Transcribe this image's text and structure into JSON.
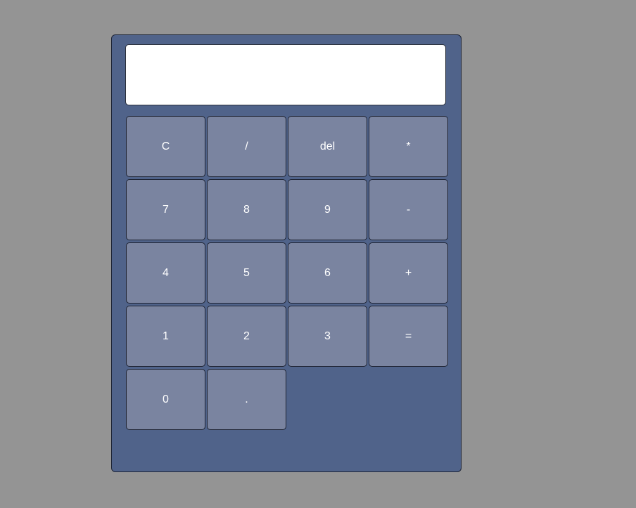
{
  "display": {
    "value": ""
  },
  "keys": [
    {
      "label": "C",
      "name": "clear-button"
    },
    {
      "label": "/",
      "name": "divide-button"
    },
    {
      "label": "del",
      "name": "delete-button"
    },
    {
      "label": "*",
      "name": "multiply-button"
    },
    {
      "label": "7",
      "name": "digit-7-button"
    },
    {
      "label": "8",
      "name": "digit-8-button"
    },
    {
      "label": "9",
      "name": "digit-9-button"
    },
    {
      "label": "-",
      "name": "subtract-button"
    },
    {
      "label": "4",
      "name": "digit-4-button"
    },
    {
      "label": "5",
      "name": "digit-5-button"
    },
    {
      "label": "6",
      "name": "digit-6-button"
    },
    {
      "label": "+",
      "name": "add-button"
    },
    {
      "label": "1",
      "name": "digit-1-button"
    },
    {
      "label": "2",
      "name": "digit-2-button"
    },
    {
      "label": "3",
      "name": "digit-3-button"
    },
    {
      "label": "=",
      "name": "equals-button"
    },
    {
      "label": "0",
      "name": "digit-0-button"
    },
    {
      "label": ".",
      "name": "decimal-button"
    }
  ],
  "colors": {
    "page_background": "#949494",
    "calculator_body": "#50638a",
    "key_background": "#7a84a0",
    "key_text": "#ffffff",
    "display_background": "#ffffff"
  }
}
